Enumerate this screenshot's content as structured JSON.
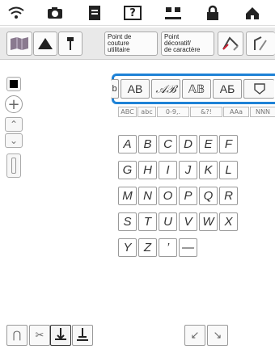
{
  "status_bar": {
    "icons": [
      "wifi-icon",
      "camera-icon",
      "document-icon",
      "help-icon",
      "needle-icon",
      "lock-icon",
      "home-icon"
    ]
  },
  "categories": {
    "utility": "Point de\ncouture\nutilitaire",
    "decorative": "Point\ndécoratif/\nde caractère"
  },
  "fonts": {
    "items": [
      "AB",
      "𝒜ℬ",
      "𝔸𝔹",
      "АБ"
    ]
  },
  "charsets": [
    "ABC",
    "abc",
    "0-9,.",
    "&?!",
    "AAa",
    "NNN"
  ],
  "keys": [
    [
      "A",
      "B",
      "C",
      "D",
      "E",
      "F"
    ],
    [
      "G",
      "H",
      "I",
      "J",
      "K",
      "L"
    ],
    [
      "M",
      "N",
      "O",
      "P",
      "Q",
      "R"
    ],
    [
      "S",
      "T",
      "U",
      "V",
      "W",
      "X"
    ],
    [
      "Y",
      "Z",
      "’",
      "—"
    ]
  ],
  "bottom": {
    "arrow_left": "↙",
    "arrow_right": "↘"
  }
}
